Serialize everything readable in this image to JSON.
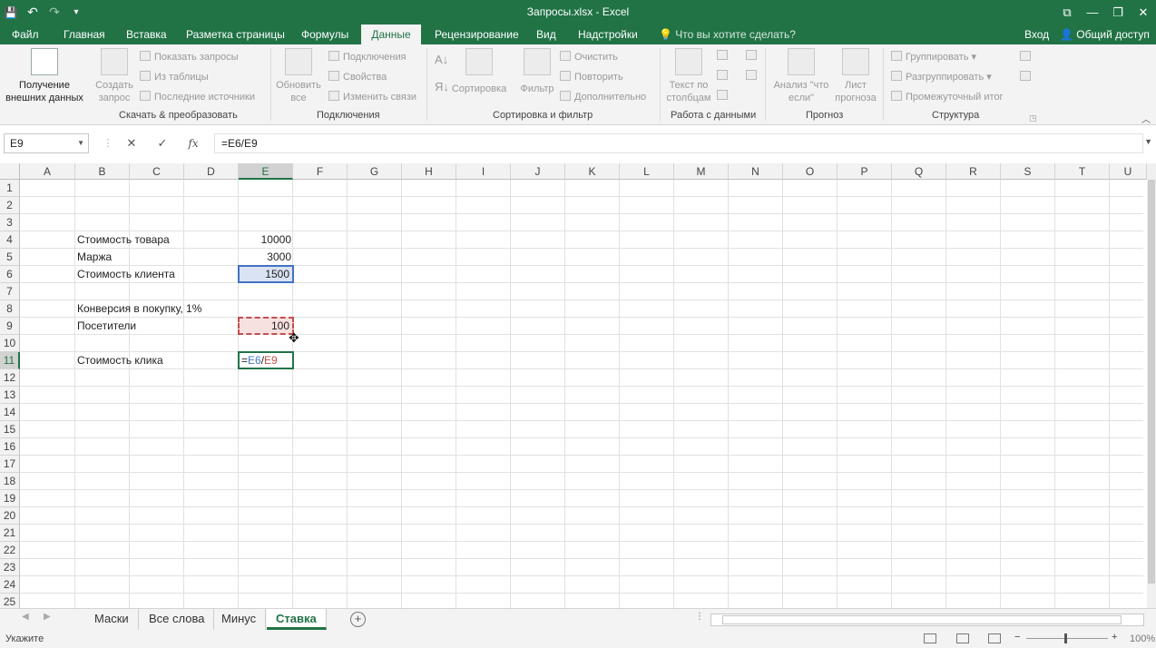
{
  "window": {
    "title": "Запросы.xlsx - Excel",
    "restore_icon": "⧉",
    "minimize_icon": "—",
    "maximize_icon": "❐",
    "close_icon": "✕"
  },
  "quick_access": {
    "save_icon": "💾",
    "undo_icon": "↶",
    "redo_icon": "↷",
    "customize_icon": "▾"
  },
  "tabs": [
    {
      "label": "Файл"
    },
    {
      "label": "Главная"
    },
    {
      "label": "Вставка"
    },
    {
      "label": "Разметка страницы"
    },
    {
      "label": "Формулы"
    },
    {
      "label": "Данные",
      "active": true
    },
    {
      "label": "Рецензирование"
    },
    {
      "label": "Вид"
    },
    {
      "label": "Надстройки"
    }
  ],
  "tell_me": "Что вы хотите сделать?",
  "login": "Вход",
  "share": "Общий доступ",
  "ribbon": {
    "get_external": "Получение внешних данных",
    "create_query": "Создать запрос",
    "show_queries": "Показать запросы",
    "from_table": "Из таблицы",
    "recent_sources": "Последние источники",
    "group_transform": "Скачать & преобразовать",
    "refresh_all": "Обновить все",
    "connections": "Подключения",
    "properties": "Свойства",
    "edit_links": "Изменить связи",
    "group_connections": "Подключения",
    "sort": "Сортировка",
    "filter": "Фильтр",
    "clear": "Очистить",
    "reapply": "Повторить",
    "advanced": "Дополнительно",
    "group_sort": "Сортировка и фильтр",
    "text_to_columns": "Текст по столбцам",
    "group_data_tools": "Работа с данными",
    "what_if": "Анализ \"что если\"",
    "forecast_sheet": "Лист прогноза",
    "group_forecast": "Прогноз",
    "group_btn": "Группировать",
    "ungroup_btn": "Разгруппировать",
    "subtotal": "Промежуточный итог",
    "group_outline": "Структура"
  },
  "formula_bar": {
    "name_box": "E9",
    "formula": "=E6/E9"
  },
  "columns": [
    "A",
    "B",
    "C",
    "D",
    "E",
    "F",
    "G",
    "H",
    "I",
    "J",
    "K",
    "L",
    "M",
    "N",
    "O",
    "P",
    "Q",
    "R",
    "S",
    "T",
    "U"
  ],
  "rows": [
    "1",
    "2",
    "3",
    "4",
    "5",
    "6",
    "7",
    "8",
    "9",
    "10",
    "11",
    "12",
    "13",
    "14",
    "15",
    "16",
    "17",
    "18",
    "19",
    "20",
    "21",
    "22",
    "23",
    "24",
    "25"
  ],
  "cells": {
    "B4": "Стоимость товара",
    "E4": "10000",
    "B5": "Маржа",
    "E5": "3000",
    "B6": "Стоимость клиента",
    "E6": "1500",
    "B8": "Конверсия в покупку, 1%",
    "B9": "Посетители",
    "E9": "100",
    "B11": "Стоимость клика",
    "E11_prefix": "=",
    "E11_ref1": "E6",
    "E11_op": "/",
    "E11_ref2": "E9"
  },
  "sheets": [
    {
      "label": "Маски"
    },
    {
      "label": "Все слова"
    },
    {
      "label": "Минус"
    },
    {
      "label": "Ставка",
      "active": true
    }
  ],
  "status": {
    "mode": "Укажите",
    "zoom": "100%"
  },
  "colors": {
    "brand": "#217346",
    "ref_blue": "#4472c4",
    "ref_red": "#c0504d"
  }
}
